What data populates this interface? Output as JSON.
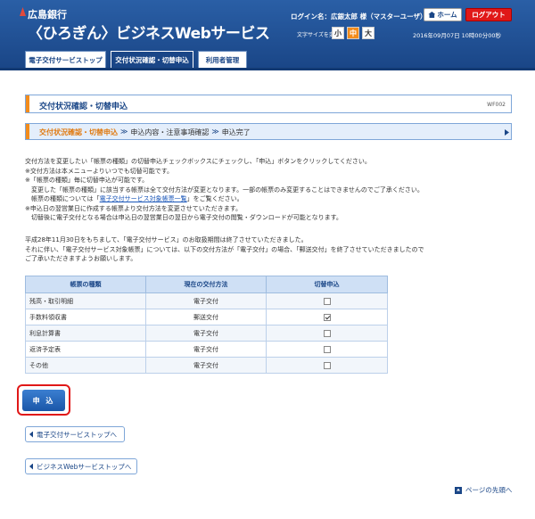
{
  "header": {
    "bank_name": "広島銀行",
    "service_name": "〈ひろぎん〉ビジネスWebサービス",
    "login_name": "ログイン名：広銀太郎 様（マスターユーザ）",
    "home_label": "ホーム",
    "logout_label": "ログアウト",
    "font_size_label": "文字サイズを変更",
    "font_sizes": [
      "小",
      "中",
      "大"
    ],
    "datetime": "2016年09月07日 10時00分00秒"
  },
  "tabs": [
    {
      "label": "電子交付サービストップ"
    },
    {
      "label": "交付状況確認・切替申込"
    },
    {
      "label": "利用者管理"
    }
  ],
  "page": {
    "title": "交付状況確認・切替申込",
    "screen_id": "WF002"
  },
  "steps": {
    "current": "交付状況確認・切替申込",
    "step2": "申込内容・注意事項確認",
    "step3": "申込完了",
    "separator": "≫"
  },
  "instructions": {
    "line1": "交付方法を変更したい「帳票の種類」の切替申込チェックボックスにチェックし、「申込」ボタンをクリックしてください。",
    "line2": "※交付方法は本メニューよりいつでも切替可能です。",
    "line3": "※「帳票の種類」毎に切替申込が可能です。",
    "line4": "　変更した「帳票の種類」に該当する帳票は全て交付方法が変更となります。一部の帳票のみ変更することはできませんのでご了承ください。",
    "line5_prefix": "　帳票の種類については「",
    "line5_link": "電子交付サービス対象帳票一覧",
    "line5_suffix": "」をご覧ください。",
    "line6": "※申込日の翌営業日に作成する帳票より交付方法を変更させていただきます。",
    "line7": "　切替後に電子交付となる場合は申込日の翌営業日の翌日から電子交付の閲覧・ダウンロードが可能となります。"
  },
  "notice": {
    "line1": "平成28年11月30日をもちまして、「電子交付サービス」のお取扱期間は終了させていただきました。",
    "line2": "それに伴い、「電子交付サービス対象帳票」については、以下の交付方法が「電子交付」の場合、「郵送交付」を終了させていただきましたので",
    "line3": "ご了承いただきますようお願いします。"
  },
  "table": {
    "headers": [
      "帳票の種類",
      "現在の交付方法",
      "切替申込"
    ],
    "rows": [
      {
        "type": "残高・取引明細",
        "method": "電子交付",
        "checked": false
      },
      {
        "type": "手数料領収書",
        "method": "郵送交付",
        "checked": true
      },
      {
        "type": "利息計算書",
        "method": "電子交付",
        "checked": false
      },
      {
        "type": "返済予定表",
        "method": "電子交付",
        "checked": false
      },
      {
        "type": "その他",
        "method": "電子交付",
        "checked": false
      }
    ]
  },
  "buttons": {
    "apply": "申 込",
    "back_to_service_top": "電子交付サービストップへ",
    "back_to_business_top": "ビジネスWebサービストップへ",
    "page_top": "ページの先頭へ"
  }
}
